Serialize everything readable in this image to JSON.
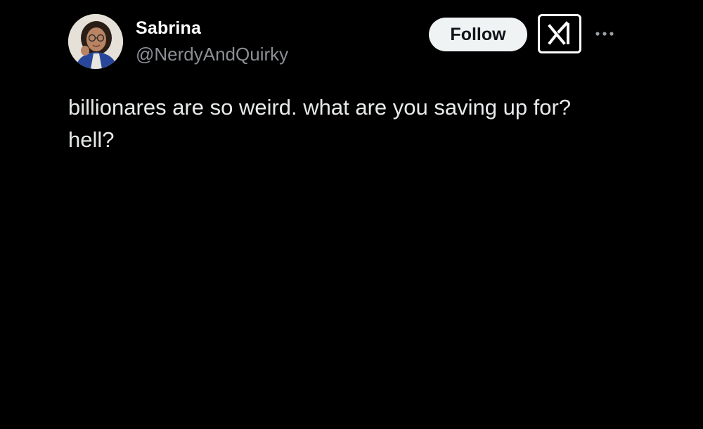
{
  "author": {
    "display_name": "Sabrina",
    "handle": "@NerdyAndQuirky",
    "avatar_icon": "profile-photo"
  },
  "actions": {
    "follow_label": "Follow",
    "grok_icon": "grok-icon",
    "more_icon": "more-horizontal-icon"
  },
  "tweet": {
    "text": "billionares are so weird. what are you saving up for? hell?"
  },
  "colors": {
    "background": "#000000",
    "text_primary": "#e7e9ea",
    "text_secondary": "#8b8f94",
    "follow_bg": "#eff3f4",
    "follow_text": "#0f1419"
  }
}
